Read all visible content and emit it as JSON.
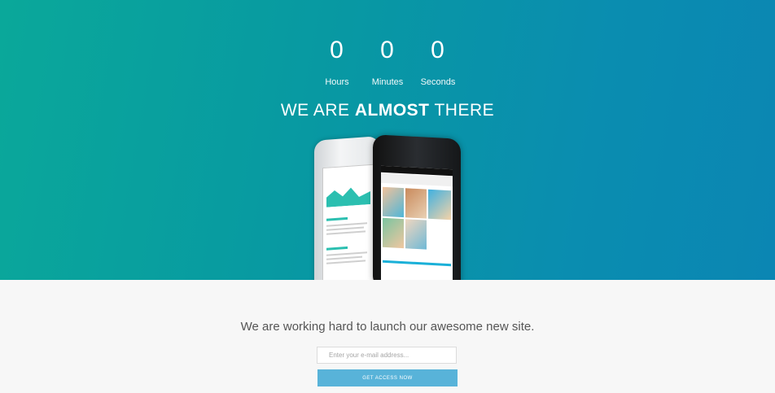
{
  "countdown": [
    {
      "value": "0",
      "label": "Hours"
    },
    {
      "value": "0",
      "label": "Minutes"
    },
    {
      "value": "0",
      "label": "Seconds"
    }
  ],
  "headline": {
    "prefix": "WE ARE ",
    "bold": "ALMOST",
    "suffix": " THERE"
  },
  "tagline": "We are working hard to launch our awesome new site.",
  "signup": {
    "email_placeholder": "Enter your e-mail address...",
    "button_label": "GET ACCESS NOW"
  },
  "colors": {
    "hero_start": "#0aa89a",
    "hero_end": "#0b86b3",
    "button": "#58b3d9",
    "background": "#f7f7f7"
  },
  "images": {
    "phones": "two-smartphones-mockup"
  }
}
